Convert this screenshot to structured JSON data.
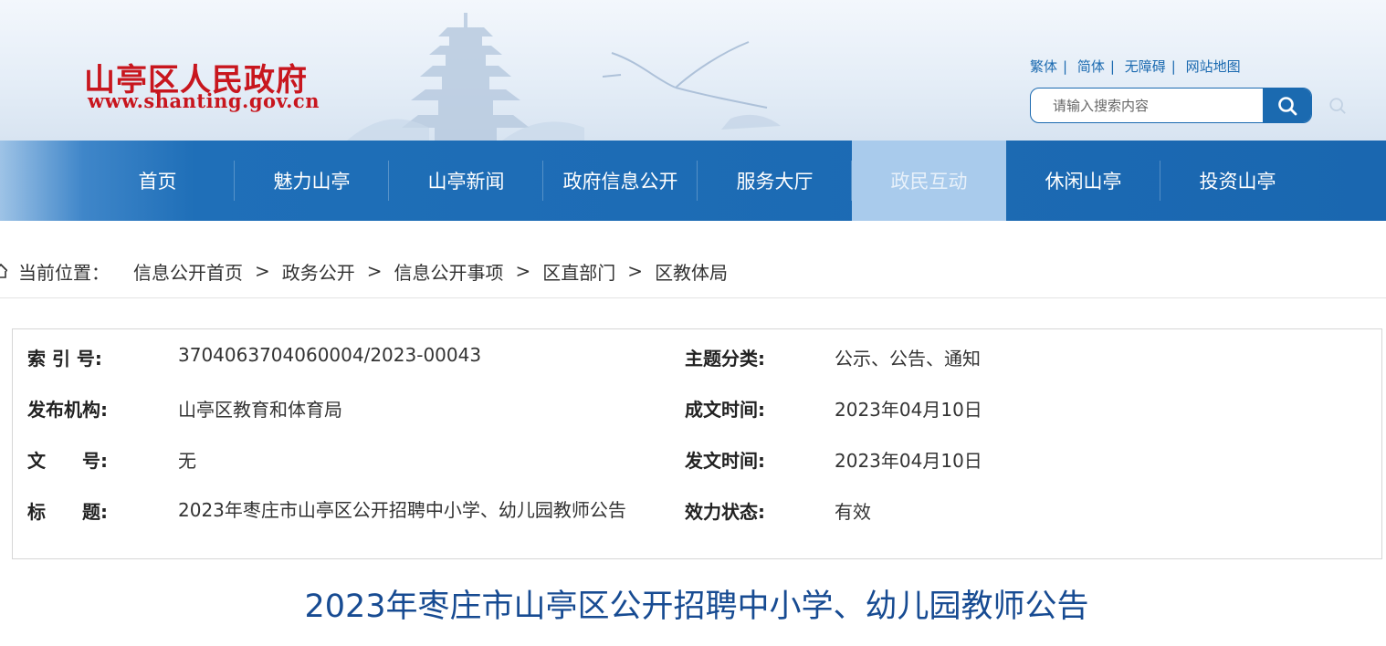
{
  "header": {
    "logo_title": "山亭区人民政府",
    "logo_url": "www.shanting.gov.cn",
    "links": [
      "繁体",
      "简体",
      "无障碍",
      "网站地图"
    ],
    "search_placeholder": "请输入搜索内容"
  },
  "nav": {
    "items": [
      "首页",
      "魅力山亭",
      "山亭新闻",
      "政府信息公开",
      "服务大厅",
      "政民互动",
      "休闲山亭",
      "投资山亭"
    ],
    "active": "政民互动"
  },
  "breadcrumb": {
    "label": "当前位置：",
    "items": [
      "信息公开首页",
      "政务公开",
      "信息公开事项",
      "区直部门",
      "区教体局"
    ],
    "separator": ">"
  },
  "info": {
    "index_label": "索 引 号:",
    "index_value": "3704063704060004/2023-00043",
    "topic_label": "主题分类:",
    "topic_value": "公示、公告、通知",
    "publisher_label": "发布机构:",
    "publisher_value": "山亭区教育和体育局",
    "created_label": "成文时间:",
    "created_value": "2023年04月10日",
    "doc_no_label": "文　　号:",
    "doc_no_value": "无",
    "issued_label": "发文时间:",
    "issued_value": "2023年04月10日",
    "title_label": "标　　题:",
    "title_value": "2023年枣庄市山亭区公开招聘中小学、幼儿园教师公告",
    "status_label": "效力状态:",
    "status_value": "有效"
  },
  "article": {
    "title": "2023年枣庄市山亭区公开招聘中小学、幼儿园教师公告"
  },
  "colors": {
    "brand_red": "#c8161e",
    "nav_blue": "#1a67b0",
    "nav_active": "#a9cbec",
    "title_blue": "#174b92"
  }
}
